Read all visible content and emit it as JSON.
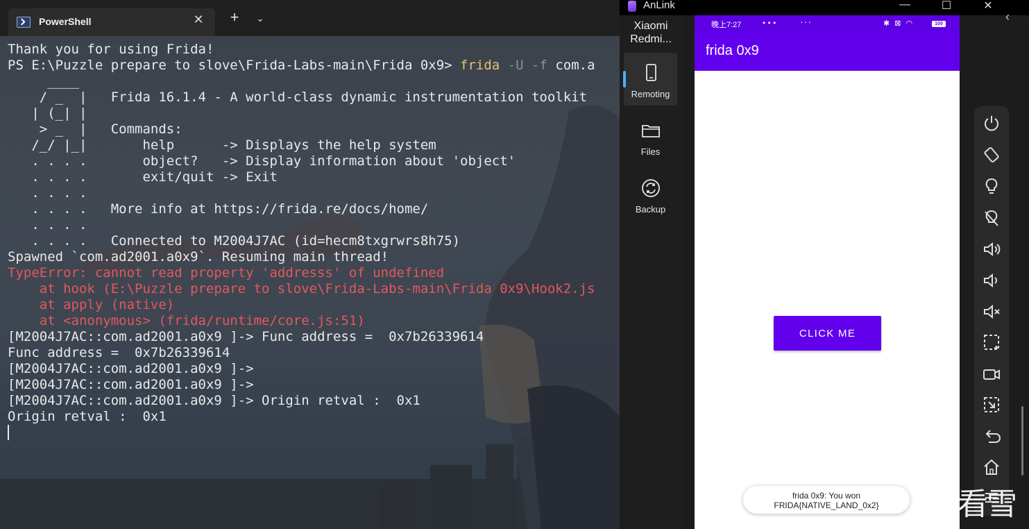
{
  "terminal": {
    "tab_title": "PowerShell",
    "new_tab": "+",
    "close": "✕",
    "dropdown": "⌄",
    "lines": [
      {
        "segments": [
          {
            "t": "Thank you for using Frida!",
            "c": ""
          }
        ]
      },
      {
        "segments": [
          {
            "t": "PS E:\\Puzzle prepare to slove\\Frida-Labs-main\\Frida 0x9> ",
            "c": ""
          },
          {
            "t": "frida",
            "c": "yel"
          },
          {
            "t": " -U -f",
            "c": "dim"
          },
          {
            "t": " com.a",
            "c": ""
          }
        ]
      },
      {
        "segments": [
          {
            "t": "     ____",
            "c": ""
          }
        ]
      },
      {
        "segments": [
          {
            "t": "    / _  |   Frida 16.1.4 - A world-class dynamic instrumentation toolkit",
            "c": ""
          }
        ]
      },
      {
        "segments": [
          {
            "t": "   | (_| |",
            "c": ""
          }
        ]
      },
      {
        "segments": [
          {
            "t": "    > _  |   Commands:",
            "c": ""
          }
        ]
      },
      {
        "segments": [
          {
            "t": "   /_/ |_|       help      -> Displays the help system",
            "c": ""
          }
        ]
      },
      {
        "segments": [
          {
            "t": "   . . . .       object?   -> Display information about 'object'",
            "c": ""
          }
        ]
      },
      {
        "segments": [
          {
            "t": "   . . . .       exit/quit -> Exit",
            "c": ""
          }
        ]
      },
      {
        "segments": [
          {
            "t": "   . . . .",
            "c": ""
          }
        ]
      },
      {
        "segments": [
          {
            "t": "   . . . .   More info at https://frida.re/docs/home/",
            "c": ""
          }
        ]
      },
      {
        "segments": [
          {
            "t": "   . . . .",
            "c": ""
          }
        ]
      },
      {
        "segments": [
          {
            "t": "   . . . .   Connected to M2004J7AC (id=hecm8txgrwrs8h75)",
            "c": ""
          }
        ]
      },
      {
        "segments": [
          {
            "t": "Spawned `com.ad2001.a0x9`. Resuming main thread!",
            "c": ""
          }
        ]
      },
      {
        "segments": [
          {
            "t": "TypeError: cannot read property 'addresss' of undefined",
            "c": "err"
          }
        ]
      },
      {
        "segments": [
          {
            "t": "    at hook (E:\\Puzzle prepare to slove\\Frida-Labs-main\\Frida 0x9\\Hook2.js",
            "c": "err"
          }
        ]
      },
      {
        "segments": [
          {
            "t": "    at apply (native)",
            "c": "err"
          }
        ]
      },
      {
        "segments": [
          {
            "t": "    at <anonymous> (frida/runtime/core.js:51)",
            "c": "err"
          }
        ]
      },
      {
        "segments": [
          {
            "t": "[M2004J7AC::com.ad2001.a0x9 ]-> Func address =  0x7b26339614",
            "c": ""
          }
        ]
      },
      {
        "segments": [
          {
            "t": "Func address =  0x7b26339614",
            "c": ""
          }
        ]
      },
      {
        "segments": [
          {
            "t": "[M2004J7AC::com.ad2001.a0x9 ]->",
            "c": ""
          }
        ]
      },
      {
        "segments": [
          {
            "t": "[M2004J7AC::com.ad2001.a0x9 ]->",
            "c": ""
          }
        ]
      },
      {
        "segments": [
          {
            "t": "[M2004J7AC::com.ad2001.a0x9 ]-> Origin retval :  0x1",
            "c": ""
          }
        ]
      },
      {
        "segments": [
          {
            "t": "Origin retval :  0x1",
            "c": ""
          }
        ]
      }
    ]
  },
  "anlink": {
    "title": "AnLink",
    "window_controls": {
      "minimize": "—",
      "maximize": "☐",
      "close": "✕"
    },
    "device_name": "Xiaomi Redmi...",
    "nav": [
      {
        "label": "Remoting",
        "icon": "phone-icon",
        "active": true
      },
      {
        "label": "Files",
        "icon": "folder-icon",
        "active": false
      },
      {
        "label": "Backup",
        "icon": "sync-icon",
        "active": false
      }
    ],
    "chevron": "‹"
  },
  "phone": {
    "status_time": "晚上7:27",
    "status_dots": "• • •",
    "status_more": "···",
    "status_right": "✱ ⊠ ◠",
    "battery": "100",
    "app_title": "frida 0x9",
    "button_label": "CLICK ME",
    "toast_line1": "frida 0x9: You won",
    "toast_line2": "FRIDA{NATIVE_LAND_0x2}"
  },
  "watermark": {
    "text": "看雪"
  },
  "colors": {
    "app_bar": "#6200ee",
    "status_bar": "#5d00e4",
    "error": "#e3585e",
    "command": "#e6c36a"
  }
}
